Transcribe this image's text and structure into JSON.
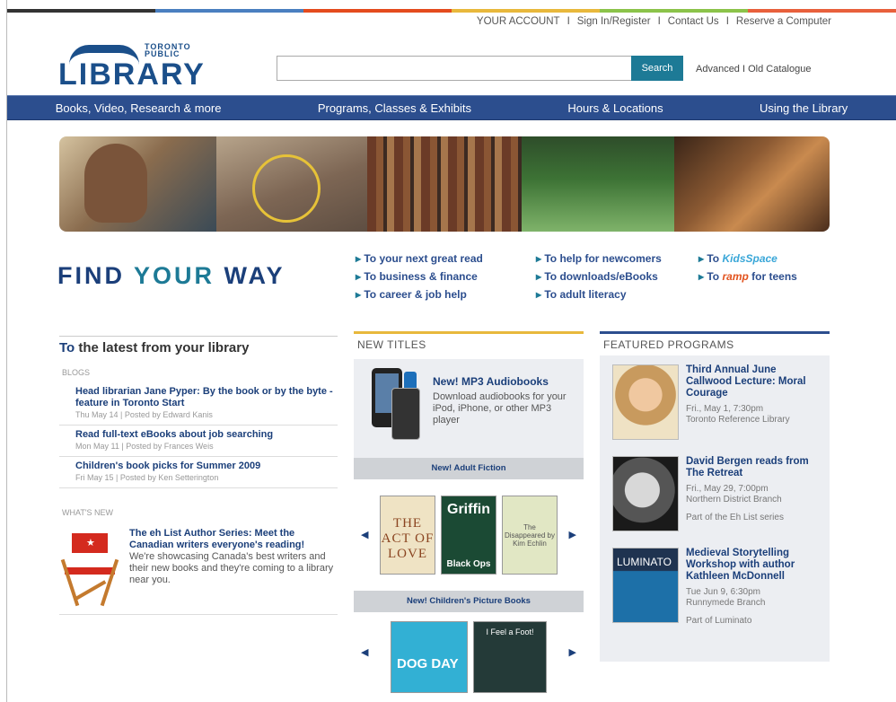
{
  "top_colors": [
    "#333333",
    "#4a7fc0",
    "#e44b1d",
    "#e8b83c",
    "#8bc34a",
    "#e8603c"
  ],
  "account_links": [
    "YOUR ACCOUNT",
    "Sign In/Register",
    "Contact Us",
    "Reserve a Computer"
  ],
  "separator": "I",
  "logo": {
    "top": "TORONTO PUBLIC",
    "main": "LIBRARY"
  },
  "search": {
    "value": "",
    "button": "Search",
    "advanced": "Advanced",
    "old_catalogue": "Old Catalogue"
  },
  "nav": [
    "Books, Video, Research & more",
    "Programs, Classes & Exhibits",
    "Hours & Locations",
    "Using the Library"
  ],
  "find_your_way": {
    "w1": "FIND",
    "w2": "YOUR",
    "w3": "WAY"
  },
  "way_links": {
    "col1": [
      "To your next great read",
      "To business & finance",
      "To career & job help"
    ],
    "col2": [
      "To help for newcomers",
      "To downloads/eBooks",
      "To adult literacy"
    ],
    "col3_a_prefix": "To",
    "col3_a_brand": "KidsSpace",
    "col3_b_prefix": "To",
    "col3_b_brand": "ramp",
    "col3_b_suffix": "for teens"
  },
  "latest": {
    "heading_to": "To",
    "heading_rest": "the latest from your library",
    "blogs_label": "BLOGS",
    "posts": [
      {
        "title": "Head librarian Jane Pyper: By the book or by the byte - feature in Toronto Start",
        "meta": "Thu May 14 | Posted by Edward Kanis"
      },
      {
        "title": "Read full-text eBooks about job searching",
        "meta": "Mon May 11 | Posted by Frances Weis"
      },
      {
        "title": "Children's book picks for Summer 2009",
        "meta": "Fri May 15 | Posted by Ken Setterington"
      }
    ],
    "whats_new_label": "WHAT'S NEW",
    "whats_new": {
      "title": "The eh List Author Series: Meet the Canadian writers everyone's reading!",
      "desc": "We're showcasing Canada's best writers and their new books and they're coming to a library near you."
    }
  },
  "new_titles": {
    "heading": "NEW TITLES",
    "feature_title": "New! MP3 Audiobooks",
    "feature_desc": "Download audiobooks for your iPod, iPhone, or other MP3 player",
    "adult_bar": "New! Adult Fiction",
    "covers": {
      "c1": "THE ACT OF LOVE",
      "c2_top": "Griffin",
      "c2_bottom": "Black Ops",
      "c3": "The Disappeared by Kim Echlin"
    },
    "children_bar": "New! Children's Picture Books",
    "covers2": {
      "c4": "DOG DAY",
      "c5": "I Feel a Foot!"
    }
  },
  "featured": {
    "heading": "FEATURED PROGRAMS",
    "items": [
      {
        "title": "Third Annual June Callwood Lecture: Moral Courage",
        "when": "Fri., May 1, 7:30pm",
        "where": "Toronto Reference Library",
        "extra": ""
      },
      {
        "title": "David Bergen reads from The Retreat",
        "when": "Fri., May 29, 7:00pm",
        "where": "Northern District Branch",
        "extra": "Part of the Eh List series"
      },
      {
        "title": "Medieval Storytelling Workshop with author Kathleen McDonnell",
        "when": "Tue Jun 9, 6:30pm",
        "where": "Runnymede Branch",
        "extra": "Part of Luminato",
        "photo_label": "LUMINATO"
      }
    ]
  }
}
